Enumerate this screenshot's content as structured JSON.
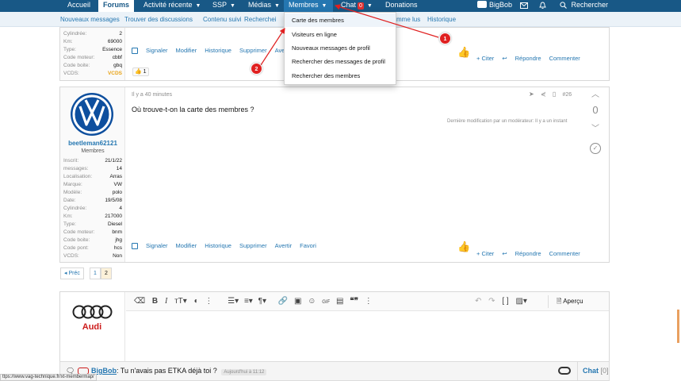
{
  "topnav": {
    "tabs": [
      {
        "label": "Accueil"
      },
      {
        "label": "Forums"
      },
      {
        "label": "Activité récente"
      },
      {
        "label": "SSP"
      },
      {
        "label": "Médias"
      },
      {
        "label": "Membres"
      },
      {
        "label": "Chat",
        "badge": "0"
      },
      {
        "label": "Donations"
      }
    ],
    "user": "BigBob",
    "search_label": "Rechercher"
  },
  "subnav": {
    "items": [
      "Nouveaux messages",
      "Trouver des discussions",
      "Contenu suivi",
      "Recherchei",
      "mme lus",
      "Historique"
    ]
  },
  "dropdown": {
    "items": [
      "Carte des membres",
      "Visiteurs en ligne",
      "Nouveaux messages de profil",
      "Rechercher des messages de profil",
      "Rechercher des membres"
    ]
  },
  "markers": {
    "m1": "1",
    "m2": "2"
  },
  "post1": {
    "rows": [
      {
        "k": "Cylindrée:",
        "v": "2"
      },
      {
        "k": "Km:",
        "v": "69000"
      },
      {
        "k": "Type:",
        "v": "Essence"
      },
      {
        "k": "Code moteur:",
        "v": "cbbf"
      },
      {
        "k": "Code boite:",
        "v": "gbq"
      },
      {
        "k": "VCDS:",
        "v": "VCDS"
      }
    ],
    "actions": [
      "Signaler",
      "Modifier",
      "Historique",
      "Supprimer",
      "Aver"
    ],
    "reaction_count": "1",
    "citer": "+ Citer",
    "repondre": "Répondre",
    "commenter": "Commenter"
  },
  "post2": {
    "time": "Il y a 40 minutes",
    "post_number": "#26",
    "message": "Où trouve-t-on la carte des membres ?",
    "edit_note": "Dernière modification par un modérateur: Il y a un instant",
    "username": "beetleman62121",
    "role": "Membres",
    "rows": [
      {
        "k": "Inscrit:",
        "v": "21/1/22"
      },
      {
        "k": "messages:",
        "v": "14"
      },
      {
        "k": "Localisation:",
        "v": "Arras"
      },
      {
        "k": "Marque:",
        "v": "VW"
      },
      {
        "k": "Modèle:",
        "v": "polo"
      },
      {
        "k": "Date:",
        "v": "19/5/08"
      },
      {
        "k": "Cylindrée:",
        "v": "4"
      },
      {
        "k": "Km:",
        "v": "217000"
      },
      {
        "k": "Type:",
        "v": "Diesel"
      },
      {
        "k": "Code moteur:",
        "v": "bnm"
      },
      {
        "k": "Code boite:",
        "v": "jhg"
      },
      {
        "k": "Code pont:",
        "v": "hcs"
      },
      {
        "k": "VCDS:",
        "v": "Non"
      }
    ],
    "actions": [
      "Signaler",
      "Modifier",
      "Historique",
      "Supprimer",
      "Avertir",
      "Favori"
    ],
    "vote_count": "0",
    "citer": "+ Citer",
    "repondre": "Répondre",
    "commenter": "Commenter"
  },
  "pager": {
    "prev": "◂ Préc",
    "pages": [
      "1",
      "2"
    ]
  },
  "editor": {
    "preview": "Aperçu",
    "logo_text": "Audi"
  },
  "chat": {
    "user": "BigBob",
    "message": ": Tu n'avais pas ETKA déjà toi ?",
    "time": "Aujourd'hui à 11:12",
    "label": "Chat",
    "count": "[0]"
  },
  "status_url": "ttps://www.vag-technique.fr/xt-membermap/",
  "colors": {
    "nav": "#185886",
    "accent": "#2577b1",
    "marker": "#e02020"
  }
}
